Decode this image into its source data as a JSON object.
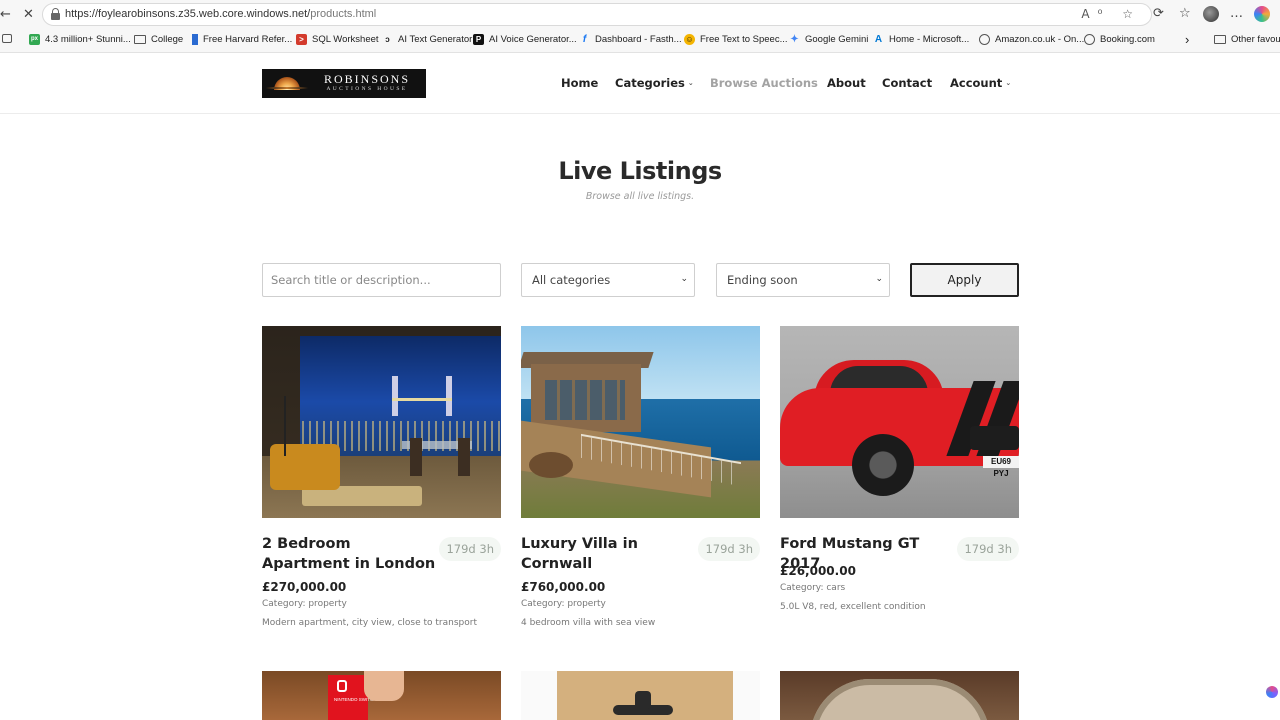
{
  "browser": {
    "url_host": "https://foylearobinsons.z35.web.core.windows.net/",
    "url_path": "products.html",
    "back_glyph": "←",
    "reload_glyph": "✕",
    "url_icons": "A⁰ ☆",
    "tool_glyphs": [
      "⟳",
      "☆",
      "…"
    ],
    "favourites": [
      {
        "label": "4.3 million+ Stunni...",
        "icon": "px-icon",
        "color": "#32a852",
        "glyph": "px"
      },
      {
        "label": "College",
        "icon": "folder-icon",
        "color": "",
        "glyph": ""
      },
      {
        "label": "Free Harvard Refer...",
        "icon": "bookmark-icon",
        "color": "#2a6ad1",
        "glyph": ""
      },
      {
        "label": "SQL Worksheet",
        "icon": "sql-icon",
        "color": "#d33a2c",
        "glyph": ">"
      },
      {
        "label": "AI Text Generator",
        "icon": "ai-text-icon",
        "color": "#222222",
        "glyph": "ↄ"
      },
      {
        "label": "AI Voice Generator...",
        "icon": "ai-voice-icon",
        "color": "#111111",
        "glyph": "P"
      },
      {
        "label": "Dashboard - Fasth...",
        "icon": "facebook-icon",
        "color": "#1877f2",
        "glyph": "f"
      },
      {
        "label": "Free Text to Speec...",
        "icon": "smiley-icon",
        "color": "#f4b400",
        "glyph": "☺"
      },
      {
        "label": "Google Gemini",
        "icon": "gemini-icon",
        "color": "#4285f4",
        "glyph": "✦"
      },
      {
        "label": "Home - Microsoft...",
        "icon": "azure-icon",
        "color": "#0078d4",
        "glyph": "A"
      },
      {
        "label": "Amazon.co.uk - On...",
        "icon": "globe-icon",
        "color": "",
        "glyph": ""
      },
      {
        "label": "Booking.com",
        "icon": "globe-icon",
        "color": "",
        "glyph": ""
      }
    ],
    "more_glyph": "›",
    "other_favourites": "Other favourit"
  },
  "site": {
    "logo_line1": "ROBINSONS",
    "logo_line2": "AUCTIONS HOUSE",
    "nav": {
      "home": "Home",
      "categories": "Categories",
      "browse": "Browse Auctions",
      "about": "About",
      "contact": "Contact",
      "account": "Account",
      "caret": "⌄"
    }
  },
  "hero": {
    "title": "Live Listings",
    "subtitle": "Browse all live listings."
  },
  "filters": {
    "search_placeholder": "Search title or description...",
    "category_selected": "All categories",
    "sort_selected": "Ending soon",
    "select_chevron": "⌄",
    "apply_label": "Apply"
  },
  "listings": [
    {
      "title": "2 Bedroom Apartment in London",
      "time_left": "179d 3h",
      "price": "£270,000.00",
      "category": "Category: property",
      "description": "Modern apartment, city view, close to transport"
    },
    {
      "title": "Luxury Villa in Cornwall",
      "time_left": "179d 3h",
      "price": "£760,000.00",
      "category": "Category: property",
      "description": "4 bedroom villa with sea view"
    },
    {
      "title": "Ford Mustang GT 2017",
      "time_left": "179d 3h",
      "price": "£26,000.00",
      "category": "Category: cars",
      "description": "5.0L V8, red, excellent condition",
      "plate_text": "EU69 PYJ"
    }
  ],
  "switch_box_label": "NINTENDO SWITCH"
}
